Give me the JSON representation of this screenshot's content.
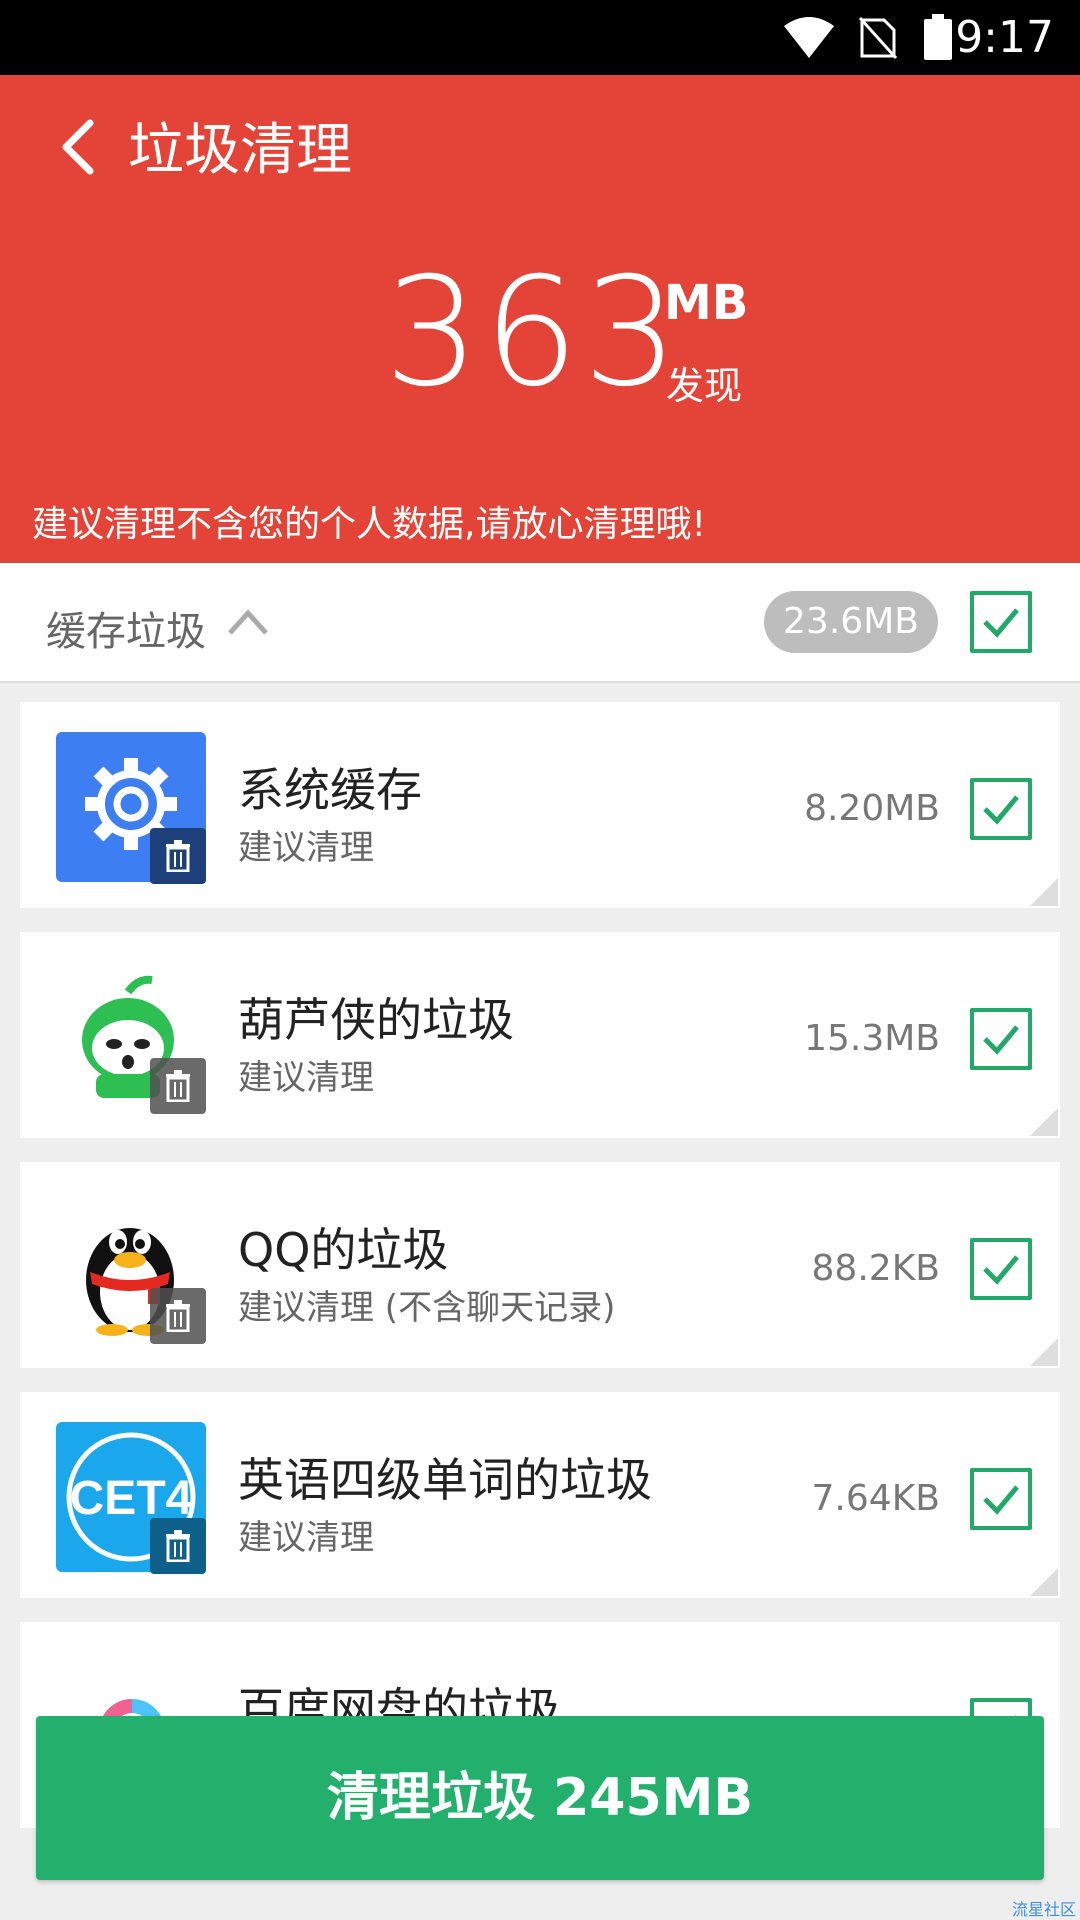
{
  "status_bar": {
    "time": "9:17"
  },
  "header": {
    "title": "垃圾清理",
    "found_size": "363",
    "found_unit": "MB",
    "found_label": "发现",
    "note": "建议清理不含您的个人数据,请放心清理哦!"
  },
  "section": {
    "title": "缓存垃圾",
    "size": "23.6MB",
    "checked": true
  },
  "items": [
    {
      "name": "系统缓存",
      "sub": "建议清理",
      "size": "8.20MB",
      "icon": "gear-icon",
      "checked": true
    },
    {
      "name": "葫芦侠的垃圾",
      "sub": "建议清理",
      "size": "15.3MB",
      "icon": "huluxia-icon",
      "checked": true
    },
    {
      "name": "QQ的垃圾",
      "sub": "建议清理 (不含聊天记录)",
      "size": "88.2KB",
      "icon": "qq-penguin-icon",
      "checked": true
    },
    {
      "name": "英语四级单词的垃圾",
      "sub": "建议清理",
      "size": "7.64KB",
      "icon": "cet4-icon",
      "icon_text": "CET4",
      "checked": true
    },
    {
      "name": "百度网盘的垃圾",
      "sub": "",
      "size": "",
      "icon": "baidu-netdisk-icon",
      "checked": true
    }
  ],
  "bottom_button": {
    "label": "清理垃圾 245MB"
  },
  "watermark": "流星社区",
  "colors": {
    "header_red": "#e44437",
    "accent_green": "#22b06c",
    "check_green": "#22a868"
  }
}
